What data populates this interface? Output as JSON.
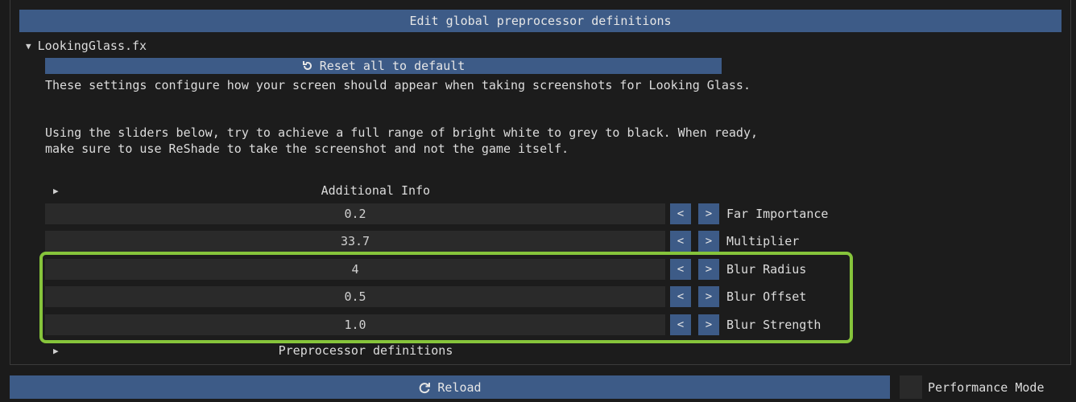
{
  "header": {
    "title": "Edit global preprocessor definitions"
  },
  "effect": {
    "name": "LookingGlass.fx"
  },
  "reset_button": {
    "label": "Reset all to default",
    "icon": "reset-icon"
  },
  "description": {
    "line1": "These settings configure how your screen should appear when taking screenshots for Looking Glass.",
    "line2": "Using the sliders below, try to achieve a full range of bright white to grey to black. When ready,",
    "line3": "make sure to use ReShade to take the screenshot and not the game itself."
  },
  "sections": {
    "additional_info": "Additional Info",
    "preprocessor": "Preprocessor definitions"
  },
  "controls": [
    {
      "label": "Far Importance",
      "value": "0.2"
    },
    {
      "label": "Multiplier",
      "value": "33.7"
    },
    {
      "label": "Blur Radius",
      "value": "4"
    },
    {
      "label": "Blur Offset",
      "value": "0.5"
    },
    {
      "label": "Blur Strength",
      "value": "1.0"
    }
  ],
  "stepper": {
    "decrease": "<",
    "increase": ">"
  },
  "footer": {
    "reload_label": "Reload",
    "reload_icon": "refresh-icon",
    "performance_mode_label": "Performance Mode"
  },
  "colors": {
    "accent": "#3d5b87",
    "highlight": "#86c43b",
    "background": "#1b1b1b",
    "field": "#2a2a2a"
  }
}
